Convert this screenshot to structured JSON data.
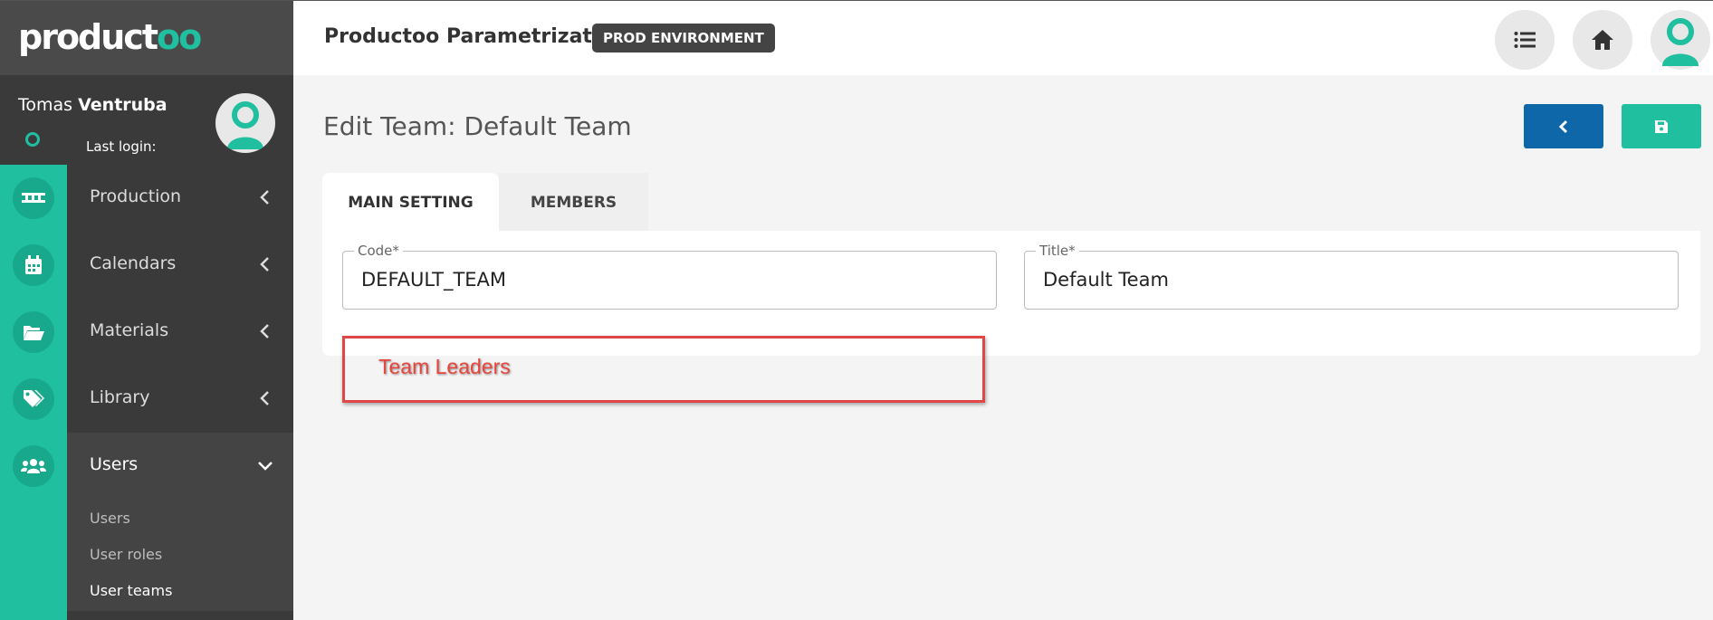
{
  "sidebar": {
    "logo_text_main": "product",
    "logo_text_accent": "oo",
    "user": {
      "first_name": "Tomas",
      "last_name": "Ventruba",
      "last_login_label": "Last login:"
    },
    "nav_items": [
      {
        "label": "Production",
        "icon": "conveyor-icon"
      },
      {
        "label": "Calendars",
        "icon": "calendar-icon"
      },
      {
        "label": "Materials",
        "icon": "folder-open-icon"
      },
      {
        "label": "Library",
        "icon": "tags-icon"
      },
      {
        "label": "Users",
        "icon": "users-icon"
      }
    ],
    "sub_items": [
      {
        "label": "Users"
      },
      {
        "label": "User roles"
      },
      {
        "label": "User teams"
      }
    ]
  },
  "topbar": {
    "title": "Productoo Parametrization",
    "env_badge": "PROD ENVIRONMENT"
  },
  "main": {
    "page_title": "Edit Team: Default Team",
    "tabs": [
      {
        "label": "MAIN SETTING"
      },
      {
        "label": "MEMBERS"
      }
    ],
    "fields": {
      "code": {
        "label": "Code*",
        "value": "DEFAULT_TEAM"
      },
      "title": {
        "label": "Title*",
        "value": "Default Team"
      }
    }
  },
  "annotation": {
    "label": "Team Leaders"
  },
  "colors": {
    "accent": "#1fbf9f",
    "sidebar_bg": "#3a3a3a",
    "back_button": "#0d67a8",
    "annotation": "#e04646"
  }
}
